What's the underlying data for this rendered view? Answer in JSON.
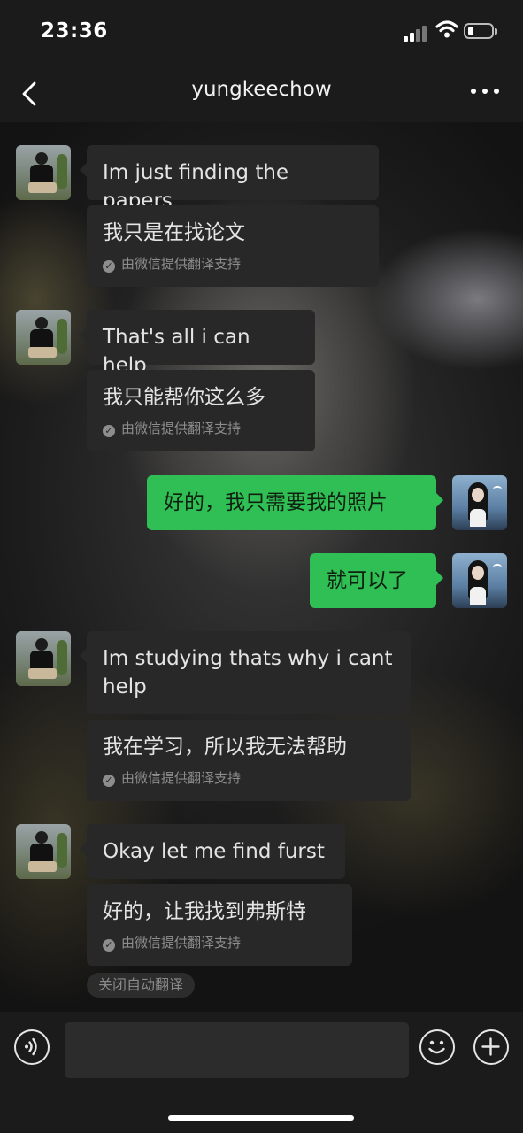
{
  "status_bar": {
    "time": "23:36"
  },
  "header": {
    "title": "yungkeechow"
  },
  "messages": [
    {
      "sender": "contact",
      "text": "Im just finding the papers",
      "translation": "我只是在找论文"
    },
    {
      "sender": "contact",
      "text": "That's all i can help",
      "translation": "我只能帮你这么多"
    },
    {
      "sender": "me",
      "text": "好的，我只需要我的照片"
    },
    {
      "sender": "me",
      "text": "就可以了"
    },
    {
      "sender": "contact",
      "text": "Im studying thats why i cant help",
      "translation": "我在学习，所以我无法帮助"
    },
    {
      "sender": "contact",
      "text": "Okay let me find furst",
      "translation": "好的，让我找到弗斯特"
    }
  ],
  "translation_note": "由微信提供翻译支持",
  "auto_translate_toggle": "关闭自动翻译",
  "colors": {
    "outgoing_bubble": "#2fbf55",
    "incoming_bubble": "#282828",
    "bar_background": "#1b1b1b"
  },
  "icons": {
    "back": "chevron-left-icon",
    "more": "ellipsis-icon",
    "voice": "voice-icon",
    "emoji": "smiley-icon",
    "plus": "plus-icon",
    "check": "check-circle-icon"
  }
}
